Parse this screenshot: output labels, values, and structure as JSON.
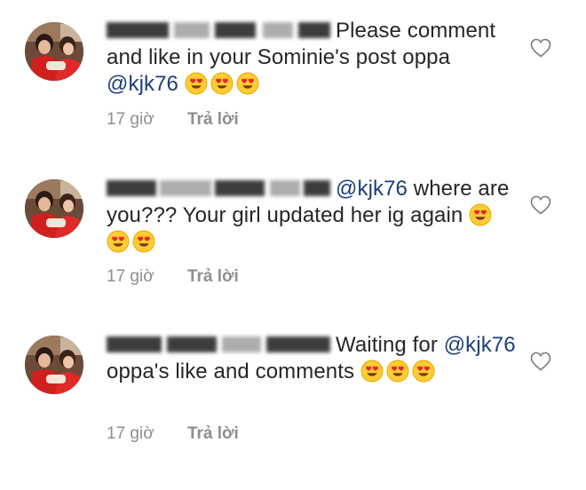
{
  "comments": [
    {
      "text": "Please comment and like in your Sominie's post oppa",
      "mention": "@kjk76",
      "time": "17 giờ",
      "reply_label": "Trả lời"
    },
    {
      "mention": "@kjk76",
      "text": "where are you??? Your girl updated her ig again",
      "time": "17 giờ",
      "reply_label": "Trả lời"
    },
    {
      "text": "Waiting for",
      "mention": "@kjk76",
      "text_after": "oppa's like and comments",
      "time": "17 giờ",
      "reply_label": "Trả lời"
    }
  ],
  "icons": {
    "like": "heart-outline-icon",
    "emoji": "heart-eyes-emoji"
  },
  "colors": {
    "text": "#262626",
    "mention": "#1c3e7a",
    "meta": "#8e8e8e"
  }
}
